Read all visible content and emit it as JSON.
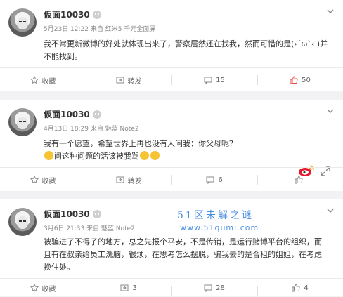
{
  "posts": [
    {
      "author": "仮面10030",
      "meta": "5月23日 12:22 来自 红米5 千元全面屏",
      "lines": [
        "我不常更新微博的好处就体现出来了，警察居然还在找我，然而可惜的是(›´ω`‹ )并",
        "不能找到。"
      ],
      "actions": {
        "collect": "收藏",
        "repost": "转发",
        "comments": "15",
        "likes": "50"
      }
    },
    {
      "author": "仮面10030",
      "meta": "4月13日 18:29 来自 魅蓝 Note2",
      "lines": [
        "我有一个愿望，希望世界上再也没有人问我：你父母呢？",
        "问这种问题的活该被我骂"
      ],
      "actions": {
        "collect": "收藏",
        "repost": "转发",
        "comments": "6",
        "likes": ""
      }
    },
    {
      "author": "仮面10030",
      "meta": "3月6日 21:33 来自 魅蓝 Note2",
      "lines": [
        "被骗进了不得了的地方，总之先报个平安，不是传销，是运行赌博平台的组织，而",
        "且有在叔亲给员工洗脑，很烦，在思考怎么摆脱，骗我去的是合租的姐姐，在考虑",
        "换住处。"
      ],
      "actions": {
        "collect": "收藏",
        "repost": "3",
        "comments": "28",
        "likes": "4"
      }
    }
  ],
  "watermark": {
    "line1": "51区未解之谜",
    "line2": "www.51qumi.com"
  },
  "colors": {
    "accent": "#4a90e2",
    "like": "#e8524a"
  },
  "icons": [
    "avatar",
    "more-icon",
    "collect-icon",
    "repost-icon",
    "comment-icon",
    "like-icon",
    "weibo-logo-icon",
    "expand-icon"
  ]
}
